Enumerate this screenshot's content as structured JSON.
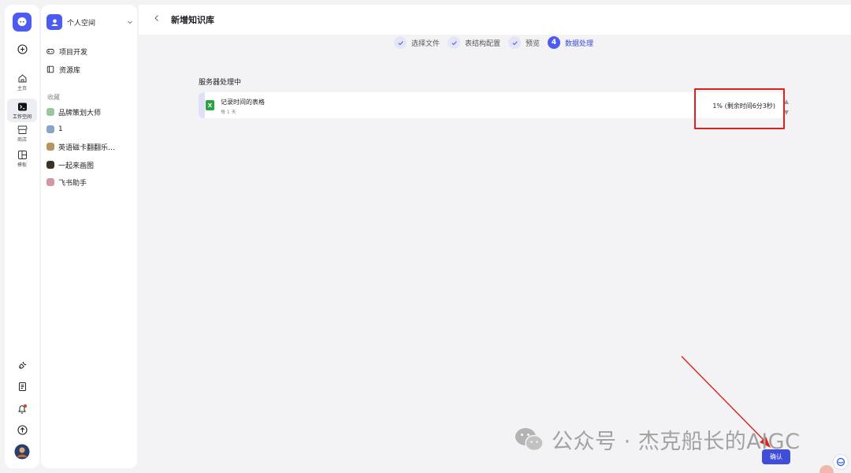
{
  "rail": {
    "items": [
      {
        "label": "主页"
      },
      {
        "label": "工作空间"
      },
      {
        "label": "商店"
      },
      {
        "label": "模板"
      }
    ]
  },
  "sidebar": {
    "space_name": "个人空间",
    "nav": [
      {
        "label": "项目开发"
      },
      {
        "label": "资源库"
      }
    ],
    "favorites_title": "收藏",
    "favorites": [
      {
        "label": "品牌策划大师",
        "color": "#9bc59a"
      },
      {
        "label": "1",
        "color": "#8aa3c9"
      },
      {
        "label": "英语磁卡翻翻乐…",
        "color": "#b8955c"
      },
      {
        "label": "一起来画图",
        "color": "#3b3126"
      },
      {
        "label": "飞书助手",
        "color": "#d29aa0"
      }
    ]
  },
  "header": {
    "title": "新增知识库"
  },
  "steps": [
    {
      "label": "选择文件",
      "state": "done"
    },
    {
      "label": "表结构配置",
      "state": "done"
    },
    {
      "label": "预览",
      "state": "done"
    },
    {
      "number": "4",
      "label": "数据处理",
      "state": "current"
    }
  ],
  "main": {
    "section_title": "服务器处理中",
    "file": {
      "icon_letter": "X",
      "name": "记录时间的表格",
      "frequency": "每 1 天",
      "progress_text": "1% (剩余时间6分3秒)"
    }
  },
  "footer": {
    "confirm_label": "确认"
  },
  "watermark": {
    "text": "公众号 · 杰克船长的AIGC"
  },
  "colors": {
    "accent": "#4e5bf0",
    "annotation": "#e0201c",
    "excel": "#2aa345"
  }
}
